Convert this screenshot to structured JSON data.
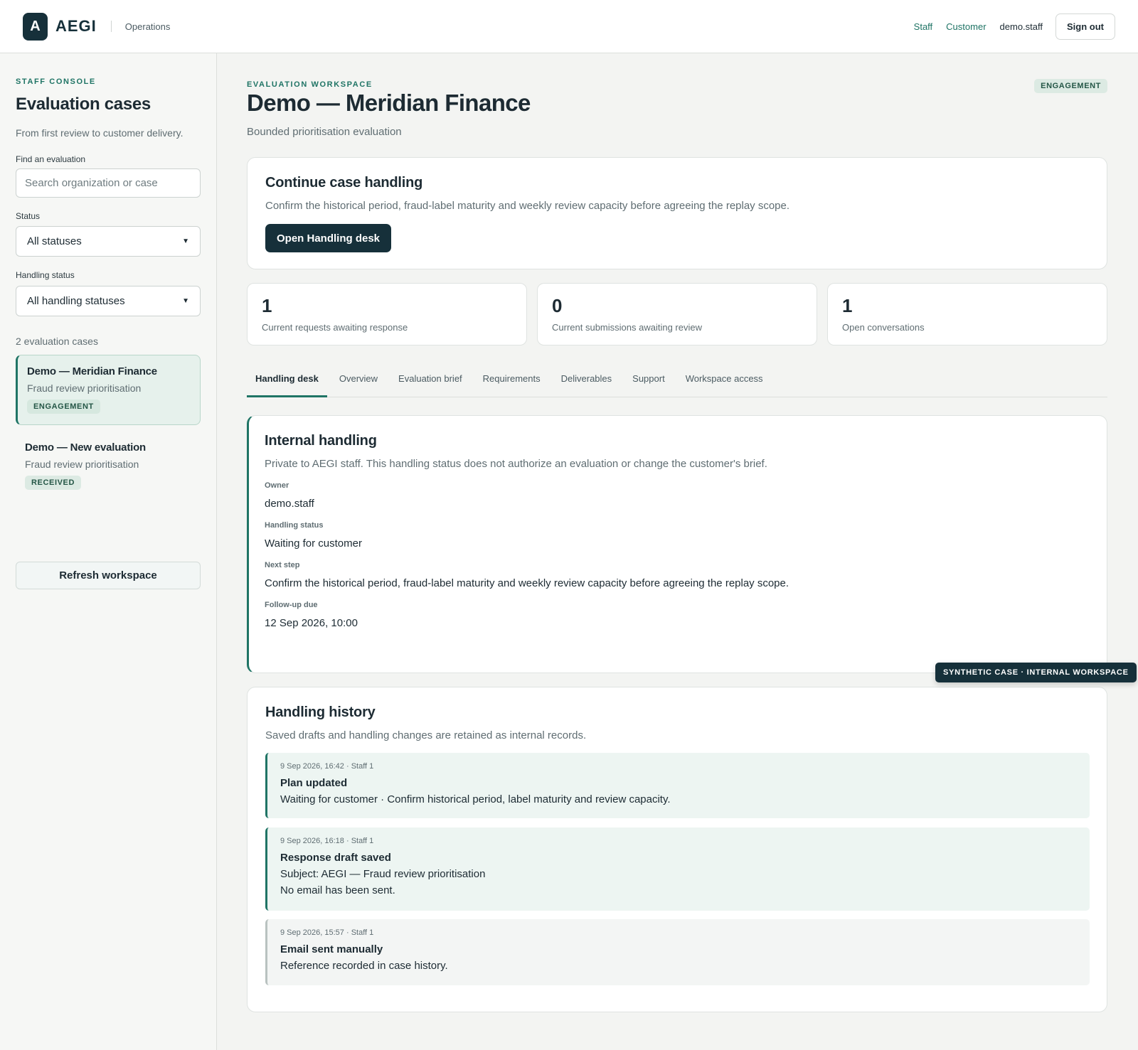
{
  "header": {
    "logo_letter": "A",
    "brand": "AEGI",
    "section": "Operations",
    "links": [
      "Staff",
      "Customer"
    ],
    "user": "demo.staff",
    "sign_out": "Sign out"
  },
  "sidebar": {
    "eyebrow": "STAFF CONSOLE",
    "title": "Evaluation cases",
    "subtitle": "From first review to customer delivery.",
    "search": {
      "label": "Find an evaluation",
      "placeholder": "Search organization or case",
      "value": ""
    },
    "status": {
      "label": "Status",
      "value": "All statuses"
    },
    "handling_status": {
      "label": "Handling status",
      "value": "All handling statuses"
    },
    "count": "2 evaluation cases",
    "cases": [
      {
        "name": "Demo — Meridian Finance",
        "type": "Fraud review prioritisation",
        "badge": "ENGAGEMENT",
        "selected": true
      },
      {
        "name": "Demo — New evaluation",
        "type": "Fraud review prioritisation",
        "badge": "RECEIVED",
        "selected": false
      }
    ],
    "refresh": "Refresh workspace"
  },
  "workspace": {
    "eyebrow": "EVALUATION WORKSPACE",
    "title": "Demo — Meridian Finance",
    "subtitle": "Bounded prioritisation evaluation",
    "badge": "ENGAGEMENT"
  },
  "continue": {
    "title": "Continue case handling",
    "text": "Confirm the historical period, fraud-label maturity and weekly review capacity before agreeing the replay scope.",
    "button": "Open Handling desk"
  },
  "stats": [
    {
      "value": "1",
      "label": "Current requests awaiting response"
    },
    {
      "value": "0",
      "label": "Current submissions awaiting review"
    },
    {
      "value": "1",
      "label": "Open conversations"
    }
  ],
  "tabs": [
    {
      "label": "Handling desk",
      "active": true
    },
    {
      "label": "Overview",
      "active": false
    },
    {
      "label": "Evaluation brief",
      "active": false
    },
    {
      "label": "Requirements",
      "active": false
    },
    {
      "label": "Deliverables",
      "active": false
    },
    {
      "label": "Support",
      "active": false
    },
    {
      "label": "Workspace access",
      "active": false
    }
  ],
  "internal": {
    "title": "Internal handling",
    "text": "Private to AEGI staff. This handling status does not authorize an evaluation or change the customer's brief.",
    "fields": [
      {
        "label": "Owner",
        "value": "demo.staff"
      },
      {
        "label": "Handling status",
        "value": "Waiting for customer"
      },
      {
        "label": "Next step",
        "value": "Confirm the historical period, fraud-label maturity and weekly review capacity before agreeing the replay scope."
      },
      {
        "label": "Follow-up due",
        "value": "12 Sep 2026, 10:00"
      }
    ]
  },
  "history": {
    "title": "Handling history",
    "text": "Saved drafts and handling changes are retained as internal records.",
    "events": [
      {
        "meta": "9 Sep 2026, 16:42 · Staff 1",
        "title": "Plan updated",
        "lines": [
          "Waiting for customer · Confirm historical period, label maturity and review capacity."
        ]
      },
      {
        "meta": "9 Sep 2026, 16:18 · Staff 1",
        "title": "Response draft saved",
        "lines": [
          "Subject: AEGI — Fraud review prioritisation",
          "No email has been sent."
        ]
      },
      {
        "meta": "9 Sep 2026, 15:57 · Staff 1",
        "title": "Email sent manually",
        "lines": [
          "Reference recorded in case history."
        ]
      }
    ]
  },
  "environment_pill": "SYNTHETIC CASE · INTERNAL WORKSPACE",
  "colors": {
    "accent": "#1f7465",
    "dark": "#16303a",
    "background": "#f3f4f2"
  }
}
